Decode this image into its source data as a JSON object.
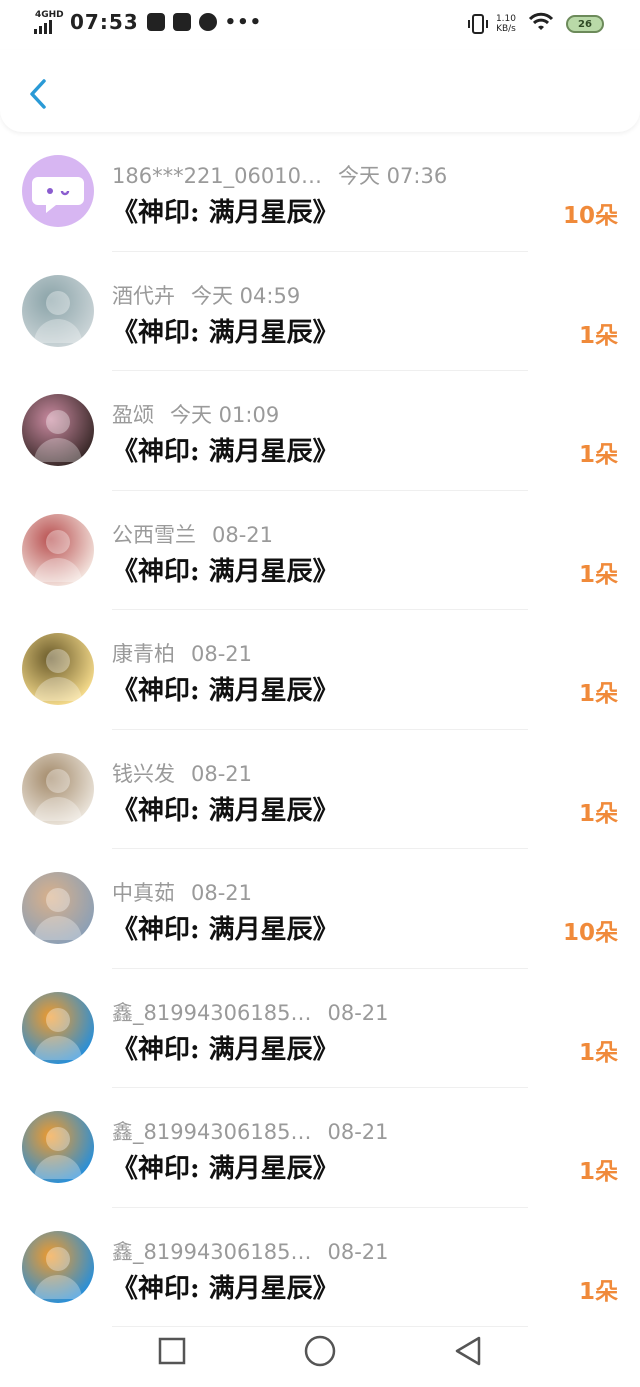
{
  "status_bar": {
    "network": "4GHD",
    "time": "07:53",
    "speed_value": "1.10",
    "speed_unit": "KB/s",
    "battery": "26"
  },
  "colors": {
    "count": "#f08a3a",
    "meta": "#9a9a9a",
    "title": "#111111",
    "back": "#2a9ad6"
  },
  "list": [
    {
      "name": "186***221_06010…",
      "time": "今天 07:36",
      "title": "《神印: 满月星辰》",
      "count": "10朵",
      "avatar": "chat-bubble-icon"
    },
    {
      "name": "酒代卉",
      "time": "今天 04:59",
      "title": "《神印: 满月星辰》",
      "count": "1朵",
      "avatar": "user-photo"
    },
    {
      "name": "盈颂",
      "time": "今天 01:09",
      "title": "《神印: 满月星辰》",
      "count": "1朵",
      "avatar": "user-photo"
    },
    {
      "name": "公西雪兰",
      "time": "08-21",
      "title": "《神印: 满月星辰》",
      "count": "1朵",
      "avatar": "user-photo"
    },
    {
      "name": "康青柏",
      "time": "08-21",
      "title": "《神印: 满月星辰》",
      "count": "1朵",
      "avatar": "user-photo"
    },
    {
      "name": "钱兴发",
      "time": "08-21",
      "title": "《神印: 满月星辰》",
      "count": "1朵",
      "avatar": "user-photo"
    },
    {
      "name": "中真茹",
      "time": "08-21",
      "title": "《神印: 满月星辰》",
      "count": "10朵",
      "avatar": "user-photo"
    },
    {
      "name": "鑫_81994306185…",
      "time": "08-21",
      "title": "《神印: 满月星辰》",
      "count": "1朵",
      "avatar": "user-photo"
    },
    {
      "name": "鑫_81994306185…",
      "time": "08-21",
      "title": "《神印: 满月星辰》",
      "count": "1朵",
      "avatar": "user-photo"
    },
    {
      "name": "鑫_81994306185…",
      "time": "08-21",
      "title": "《神印: 满月星辰》",
      "count": "1朵",
      "avatar": "user-photo"
    }
  ]
}
